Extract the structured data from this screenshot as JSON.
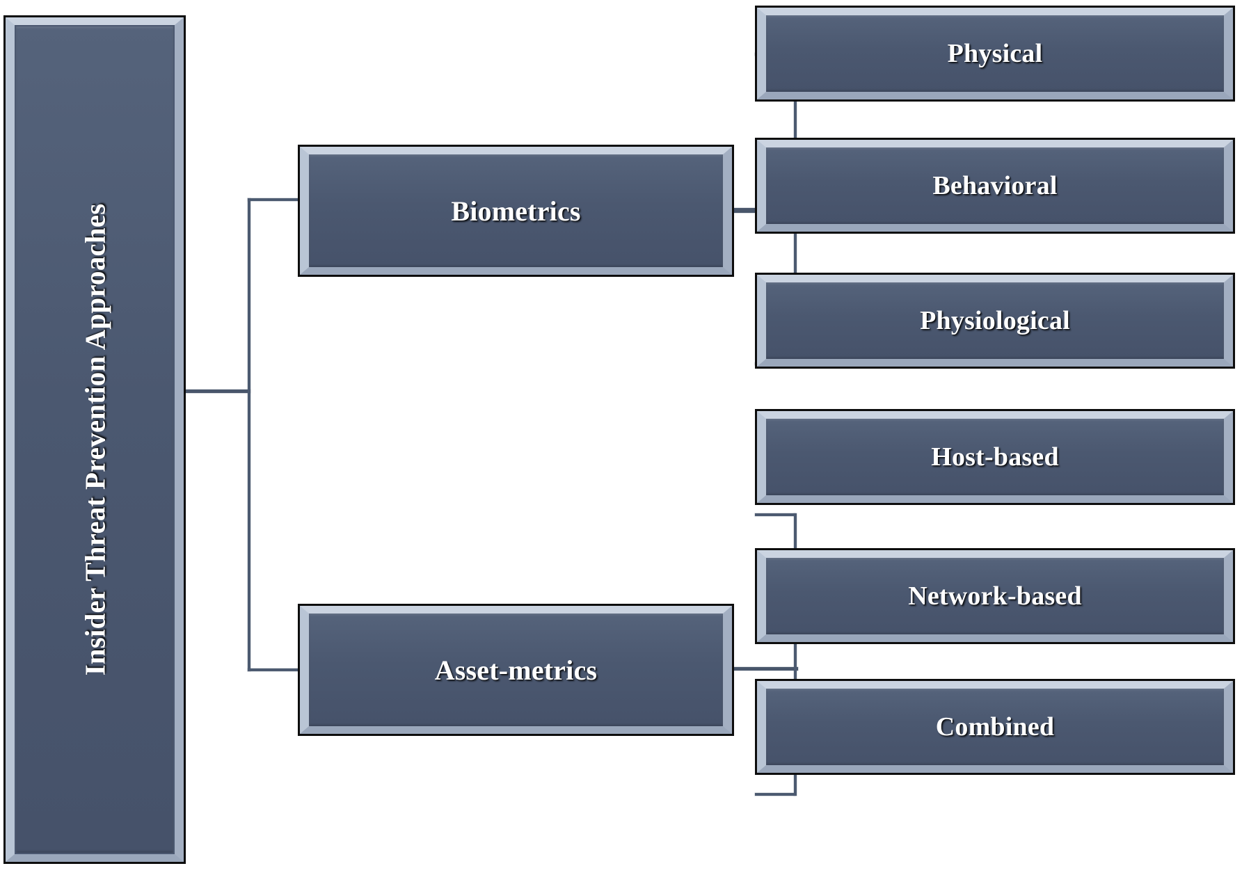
{
  "diagram": {
    "type": "hierarchy-tree",
    "orientation": "left-to-right",
    "root": {
      "label": "Insider Threat Prevention Approaches"
    },
    "branches": [
      {
        "label": "Biometrics",
        "children": [
          {
            "label": "Physical"
          },
          {
            "label": "Behavioral"
          },
          {
            "label": "Physiological"
          }
        ]
      },
      {
        "label": "Asset-metrics",
        "children": [
          {
            "label": "Host-based"
          },
          {
            "label": "Network-based"
          },
          {
            "label": "Combined"
          }
        ]
      }
    ],
    "colors": {
      "box_fill": "#4b5870",
      "box_border": "#0d0d0d",
      "bevel_highlight": "#cdd7e4",
      "connector": "#49566b",
      "label_text": "#ffffff",
      "background": "#ffffff"
    }
  }
}
